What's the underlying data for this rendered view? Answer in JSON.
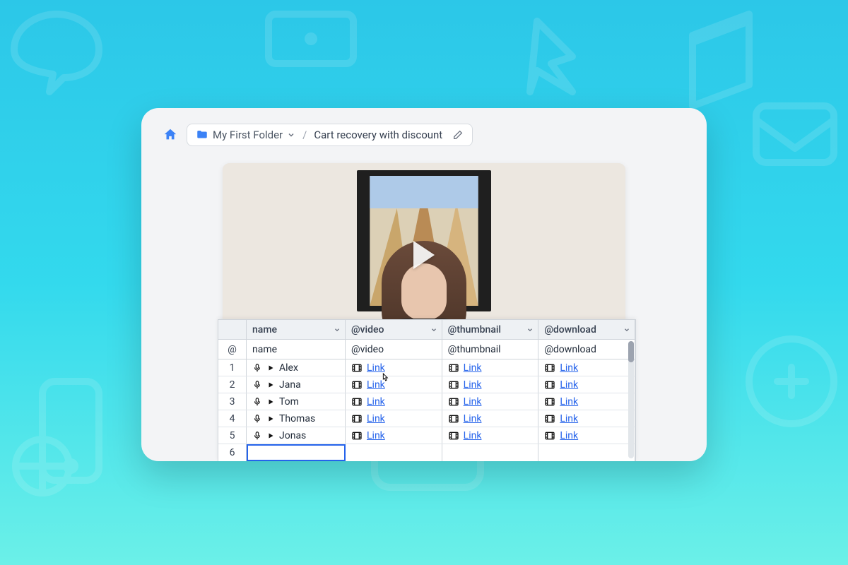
{
  "breadcrumb": {
    "folder_label": "My First Folder",
    "separator": "/",
    "title": "Cart recovery with discount"
  },
  "sheet": {
    "columns": [
      "name",
      "@video",
      "@thumbnail",
      "@download"
    ],
    "subheaders": [
      "@",
      "name",
      "@video",
      "@thumbnail",
      "@download"
    ],
    "link_label": "Link",
    "rows": [
      {
        "idx": "1",
        "name": "Alex"
      },
      {
        "idx": "2",
        "name": "Jana"
      },
      {
        "idx": "3",
        "name": "Tom"
      },
      {
        "idx": "4",
        "name": "Thomas"
      },
      {
        "idx": "5",
        "name": "Jonas"
      },
      {
        "idx": "6",
        "name": ""
      }
    ]
  }
}
